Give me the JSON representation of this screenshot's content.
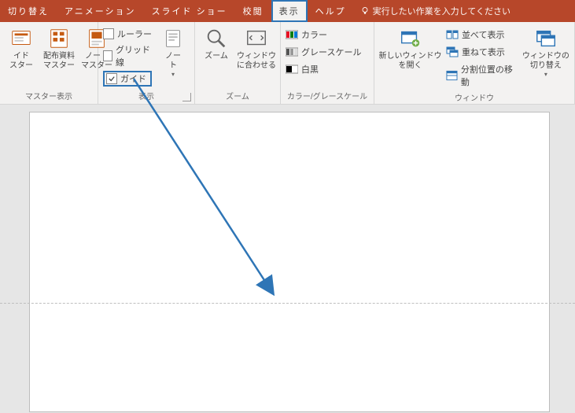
{
  "tabs": {
    "t0": "切り替え",
    "t1": "アニメーション",
    "t2": "スライド ショー",
    "t3": "校閲",
    "t4": "表示",
    "t5": "ヘルプ",
    "tell": "実行したい作業を入力してください"
  },
  "groups": {
    "master": {
      "label": "マスター表示",
      "slide": "イド\nスター",
      "handout": "配布資料\nマスター",
      "notes": "ノート\nマスター"
    },
    "show": {
      "label": "表示",
      "ruler": "ルーラー",
      "grid": "グリッド線",
      "guide": "ガイド",
      "notes": "ノー\nト"
    },
    "zoom": {
      "label": "ズーム",
      "zoom": "ズーム",
      "fit": "ウィンドウ\nに合わせる"
    },
    "color": {
      "label": "カラー/グレースケール",
      "color": "カラー",
      "gray": "グレースケール",
      "bw": "白黒"
    },
    "window": {
      "label": "ウィンドウ",
      "neww": "新しいウィンドウ\nを開く",
      "arrange": "並べて表示",
      "cascade": "重ねて表示",
      "split": "分割位置の移動",
      "switch": "ウィンドウの\n切り替え"
    }
  }
}
